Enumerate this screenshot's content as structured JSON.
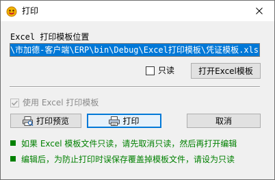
{
  "window": {
    "title": "打印",
    "app_icon": "smiley-app-icon",
    "close_icon": "close-icon"
  },
  "template_location": {
    "label": "Excel 打印模板位置",
    "path_value": "cn\\市加德-客户端\\ERP\\bin\\Debug\\Excel打印模板\\凭证模板.xls"
  },
  "readonly": {
    "label": "只读",
    "checked": false
  },
  "buttons": {
    "open_template": "打开Excel模板",
    "preview": "打印预览",
    "print": "打印",
    "cancel": "取消"
  },
  "use_excel_print": {
    "label": "使用 Excel 打印模板",
    "checked": true,
    "enabled": false
  },
  "notes": [
    "如果 Excel 模板文件只读，请先取消只读，然后再打开编辑",
    "编辑后，为防止打印时误保存覆盖掉模板文件，请设为只读"
  ],
  "colors": {
    "note_text": "#008000",
    "selection": "#0078d7",
    "default_button_border": "#0078d7"
  }
}
